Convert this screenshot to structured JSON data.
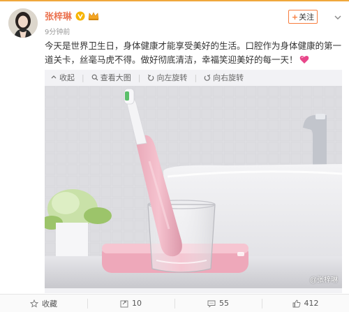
{
  "post": {
    "username": "张梓琳",
    "timestamp": "9分钟前",
    "follow_label": "关注",
    "follow_plus": "+",
    "text": "今天是世界卫生日，身体健康才能享受美好的生活。口腔作为身体健康的第一道关卡，丝毫马虎不得。做好彻底清洁，幸福笑迎美好的每一天！"
  },
  "media_toolbar": {
    "collect": "收起",
    "view_large": "查看大图",
    "rotate_left": "向左旋转",
    "rotate_right": "向右旋转"
  },
  "media": {
    "watermark": "@张梓琳"
  },
  "footer": {
    "favorite": "收藏",
    "repost": "10",
    "comment": "55",
    "like": "412"
  },
  "colors": {
    "accent": "#eb7350",
    "follow_border": "#f77c3d",
    "top_border": "#f0a83c",
    "toothbrush_pink": "#f2b8c6"
  },
  "icons": {
    "verified": "v-verified-icon",
    "crown": "crown-icon",
    "more": "chevron-down-icon",
    "heart": "heart-emoji-icon",
    "favorite": "star-icon",
    "repost": "repost-icon",
    "comment": "comment-icon",
    "like": "thumb-up-icon"
  }
}
